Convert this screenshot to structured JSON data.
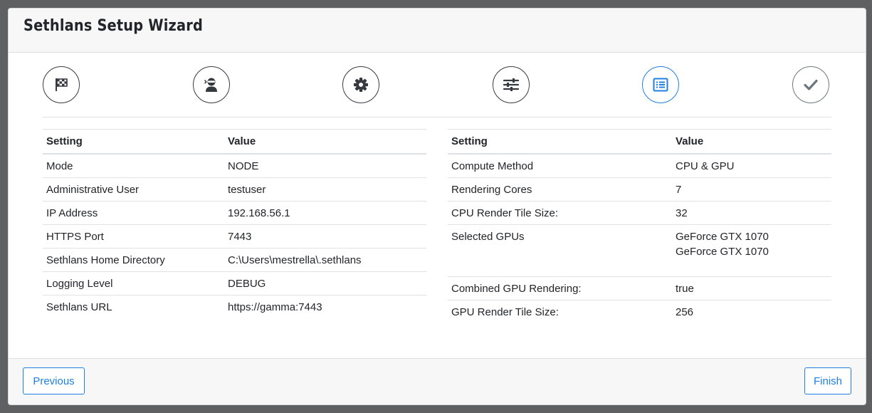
{
  "window": {
    "title": "Sethlans Setup Wizard"
  },
  "steps": [
    {
      "icon": "checkered-flag-icon",
      "state": "inactive"
    },
    {
      "icon": "user-ninja-icon",
      "state": "inactive"
    },
    {
      "icon": "gear-icon",
      "state": "inactive"
    },
    {
      "icon": "sliders-icon",
      "state": "inactive"
    },
    {
      "icon": "list-alt-icon",
      "state": "active"
    },
    {
      "icon": "checkmark-icon",
      "state": "pending"
    }
  ],
  "colors": {
    "accent": "#1e7fe0",
    "dark": "#343a40",
    "muted": "#6c757d"
  },
  "left_table": {
    "headers": [
      "Setting",
      "Value"
    ],
    "rows": [
      [
        "Mode",
        "NODE"
      ],
      [
        "Administrative User",
        "testuser"
      ],
      [
        "IP Address",
        "192.168.56.1"
      ],
      [
        "HTTPS Port",
        "7443"
      ],
      [
        "Sethlans Home Directory",
        "C:\\Users\\mestrella\\.sethlans"
      ],
      [
        "Logging Level",
        "DEBUG"
      ],
      [
        "Sethlans URL",
        "https://gamma:7443"
      ]
    ]
  },
  "right_table": {
    "headers": [
      "Setting",
      "Value"
    ],
    "rows": [
      [
        "Compute Method",
        "CPU & GPU"
      ],
      [
        "Rendering Cores",
        "7"
      ],
      [
        "CPU Render Tile Size:",
        "32"
      ],
      [
        "Selected GPUs",
        "GeForce GTX 1070",
        "GeForce GTX 1070"
      ],
      [
        "Combined GPU Rendering:",
        "true"
      ],
      [
        "GPU Render Tile Size:",
        "256"
      ]
    ]
  },
  "footer": {
    "previous_label": "Previous",
    "finish_label": "Finish"
  }
}
